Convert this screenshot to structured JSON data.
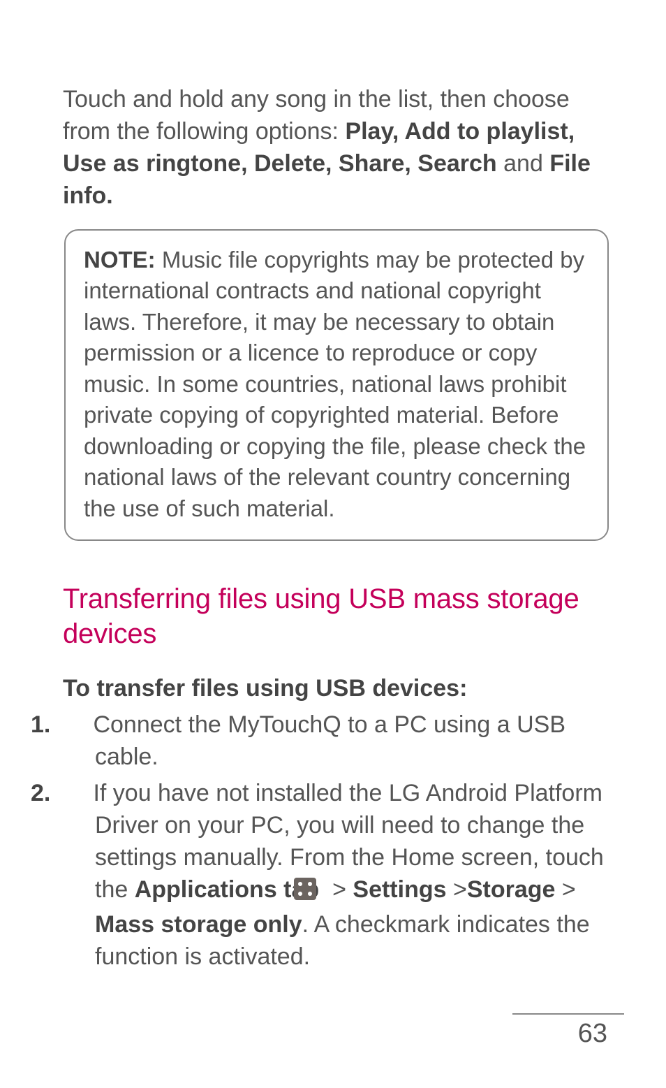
{
  "intro": {
    "pre": "Touch and hold any song in the list, then choose from the following options: ",
    "bold1": "Play, Add to playlist, Use as ringtone, Delete, Share, Search",
    "mid": " and ",
    "bold2": "File info."
  },
  "note": {
    "label": "NOTE:",
    "body": " Music file copyrights may be protected by international contracts and national copyright laws. Therefore, it may be necessary to obtain permission or a licence to reproduce or copy music. In some countries, national laws prohibit private copying of copyrighted material. Before downloading or copying the file, please check the national laws of the relevant country concerning the use of such material."
  },
  "section": {
    "title": "Transferring files using USB mass storage devices",
    "sub": "To transfer files using USB devices:"
  },
  "steps": [
    {
      "num": "1.",
      "pre": " Connect the MyTouchQ to a PC using a USB cable."
    },
    {
      "num": "2.",
      "pre": " If you have not installed the LG Android Platform Driver on your PC, you will need to change the settings manually. From the Home screen, touch the ",
      "b1": "Applications tab",
      "m1": " ",
      "icon": "applications-icon",
      "m2": " > ",
      "b2": "Settings",
      "m3": " >",
      "b3": "Storage",
      "m4": " > ",
      "b4": "Mass storage only",
      "post": ". A checkmark indicates the function is activated."
    }
  ],
  "page_number": "63"
}
